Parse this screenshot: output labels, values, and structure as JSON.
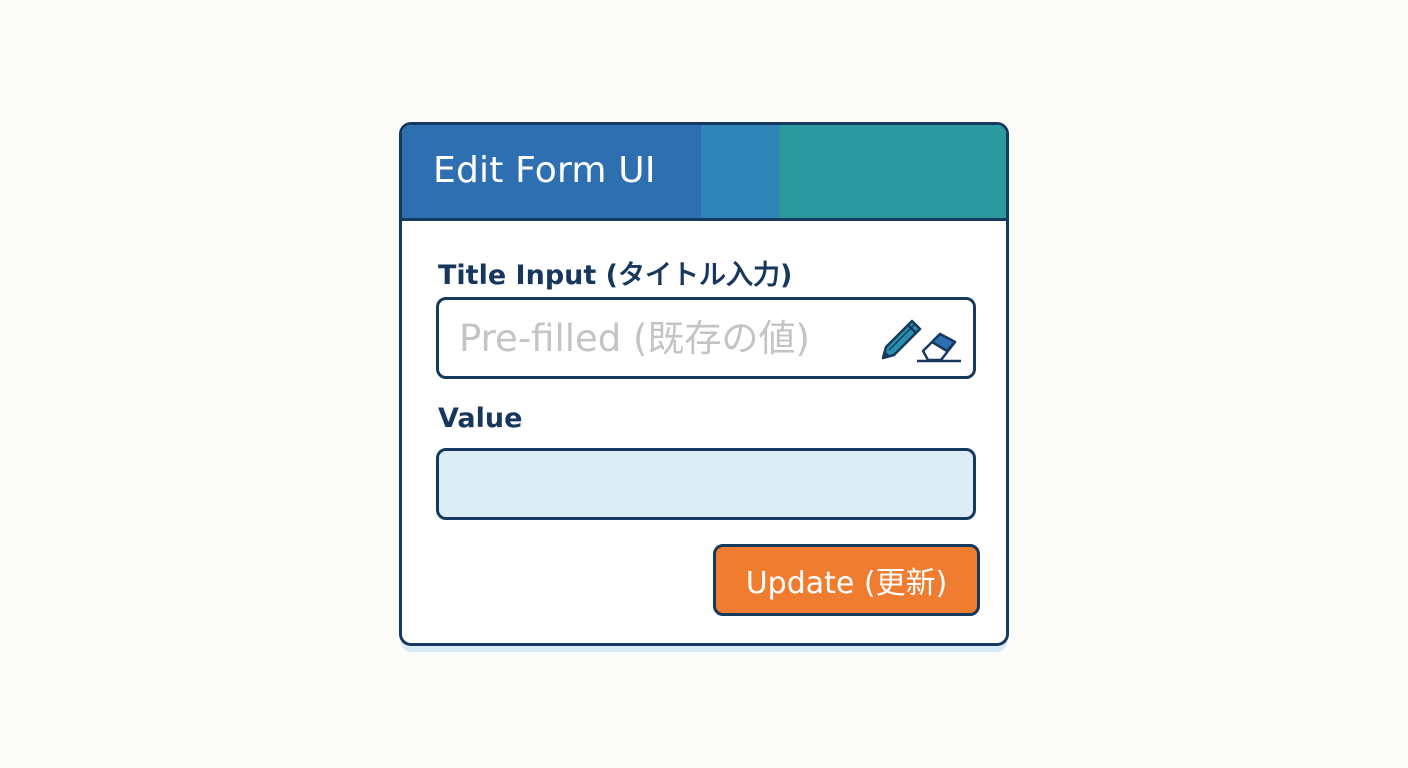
{
  "form": {
    "header_title": "Edit Form UI",
    "title_field": {
      "label": "Title Input (タイトル入力)",
      "placeholder": "Pre-filled (既存の値)",
      "icons": [
        "pencil-icon",
        "eraser-icon"
      ]
    },
    "value_field": {
      "label": "Value",
      "value": ""
    },
    "update_button_label": "Update (更新)"
  },
  "colors": {
    "header_blue": "#2d6fb0",
    "header_mid": "#2f85b8",
    "header_teal": "#2a9a9f",
    "border_navy": "#163a5f",
    "value_field_bg": "#dcedf5",
    "button_orange": "#ef7c2f",
    "placeholder_gray": "#c4c4c4"
  }
}
